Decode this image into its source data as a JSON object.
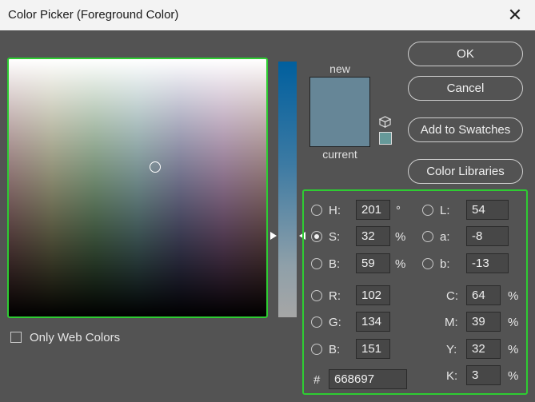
{
  "window": {
    "title": "Color Picker (Foreground Color)"
  },
  "preview": {
    "new_label": "new",
    "current_label": "current",
    "new_color": "#668697",
    "current_color": "#668697"
  },
  "buttons": {
    "ok": "OK",
    "cancel": "Cancel",
    "add_to_swatches": "Add to Swatches",
    "color_libraries": "Color Libraries"
  },
  "only_web_colors": {
    "label": "Only Web Colors",
    "checked": false
  },
  "hsb": {
    "h": {
      "label": "H:",
      "value": "201",
      "unit": "°"
    },
    "s": {
      "label": "S:",
      "value": "32",
      "unit": "%"
    },
    "b": {
      "label": "B:",
      "value": "59",
      "unit": "%"
    }
  },
  "lab": {
    "l": {
      "label": "L:",
      "value": "54"
    },
    "a": {
      "label": "a:",
      "value": "-8"
    },
    "b": {
      "label": "b:",
      "value": "-13"
    }
  },
  "rgb": {
    "r": {
      "label": "R:",
      "value": "102"
    },
    "g": {
      "label": "G:",
      "value": "134"
    },
    "b": {
      "label": "B:",
      "value": "151"
    }
  },
  "cmyk": {
    "c": {
      "label": "C:",
      "value": "64",
      "unit": "%"
    },
    "m": {
      "label": "M:",
      "value": "39",
      "unit": "%"
    },
    "y": {
      "label": "Y:",
      "value": "32",
      "unit": "%"
    },
    "k": {
      "label": "K:",
      "value": "3",
      "unit": "%"
    }
  },
  "hex": {
    "label": "#",
    "value": "668697"
  },
  "selected_mode": "S",
  "colors": {
    "highlight_border": "#2ecc32",
    "dialog_bg": "#535353"
  }
}
